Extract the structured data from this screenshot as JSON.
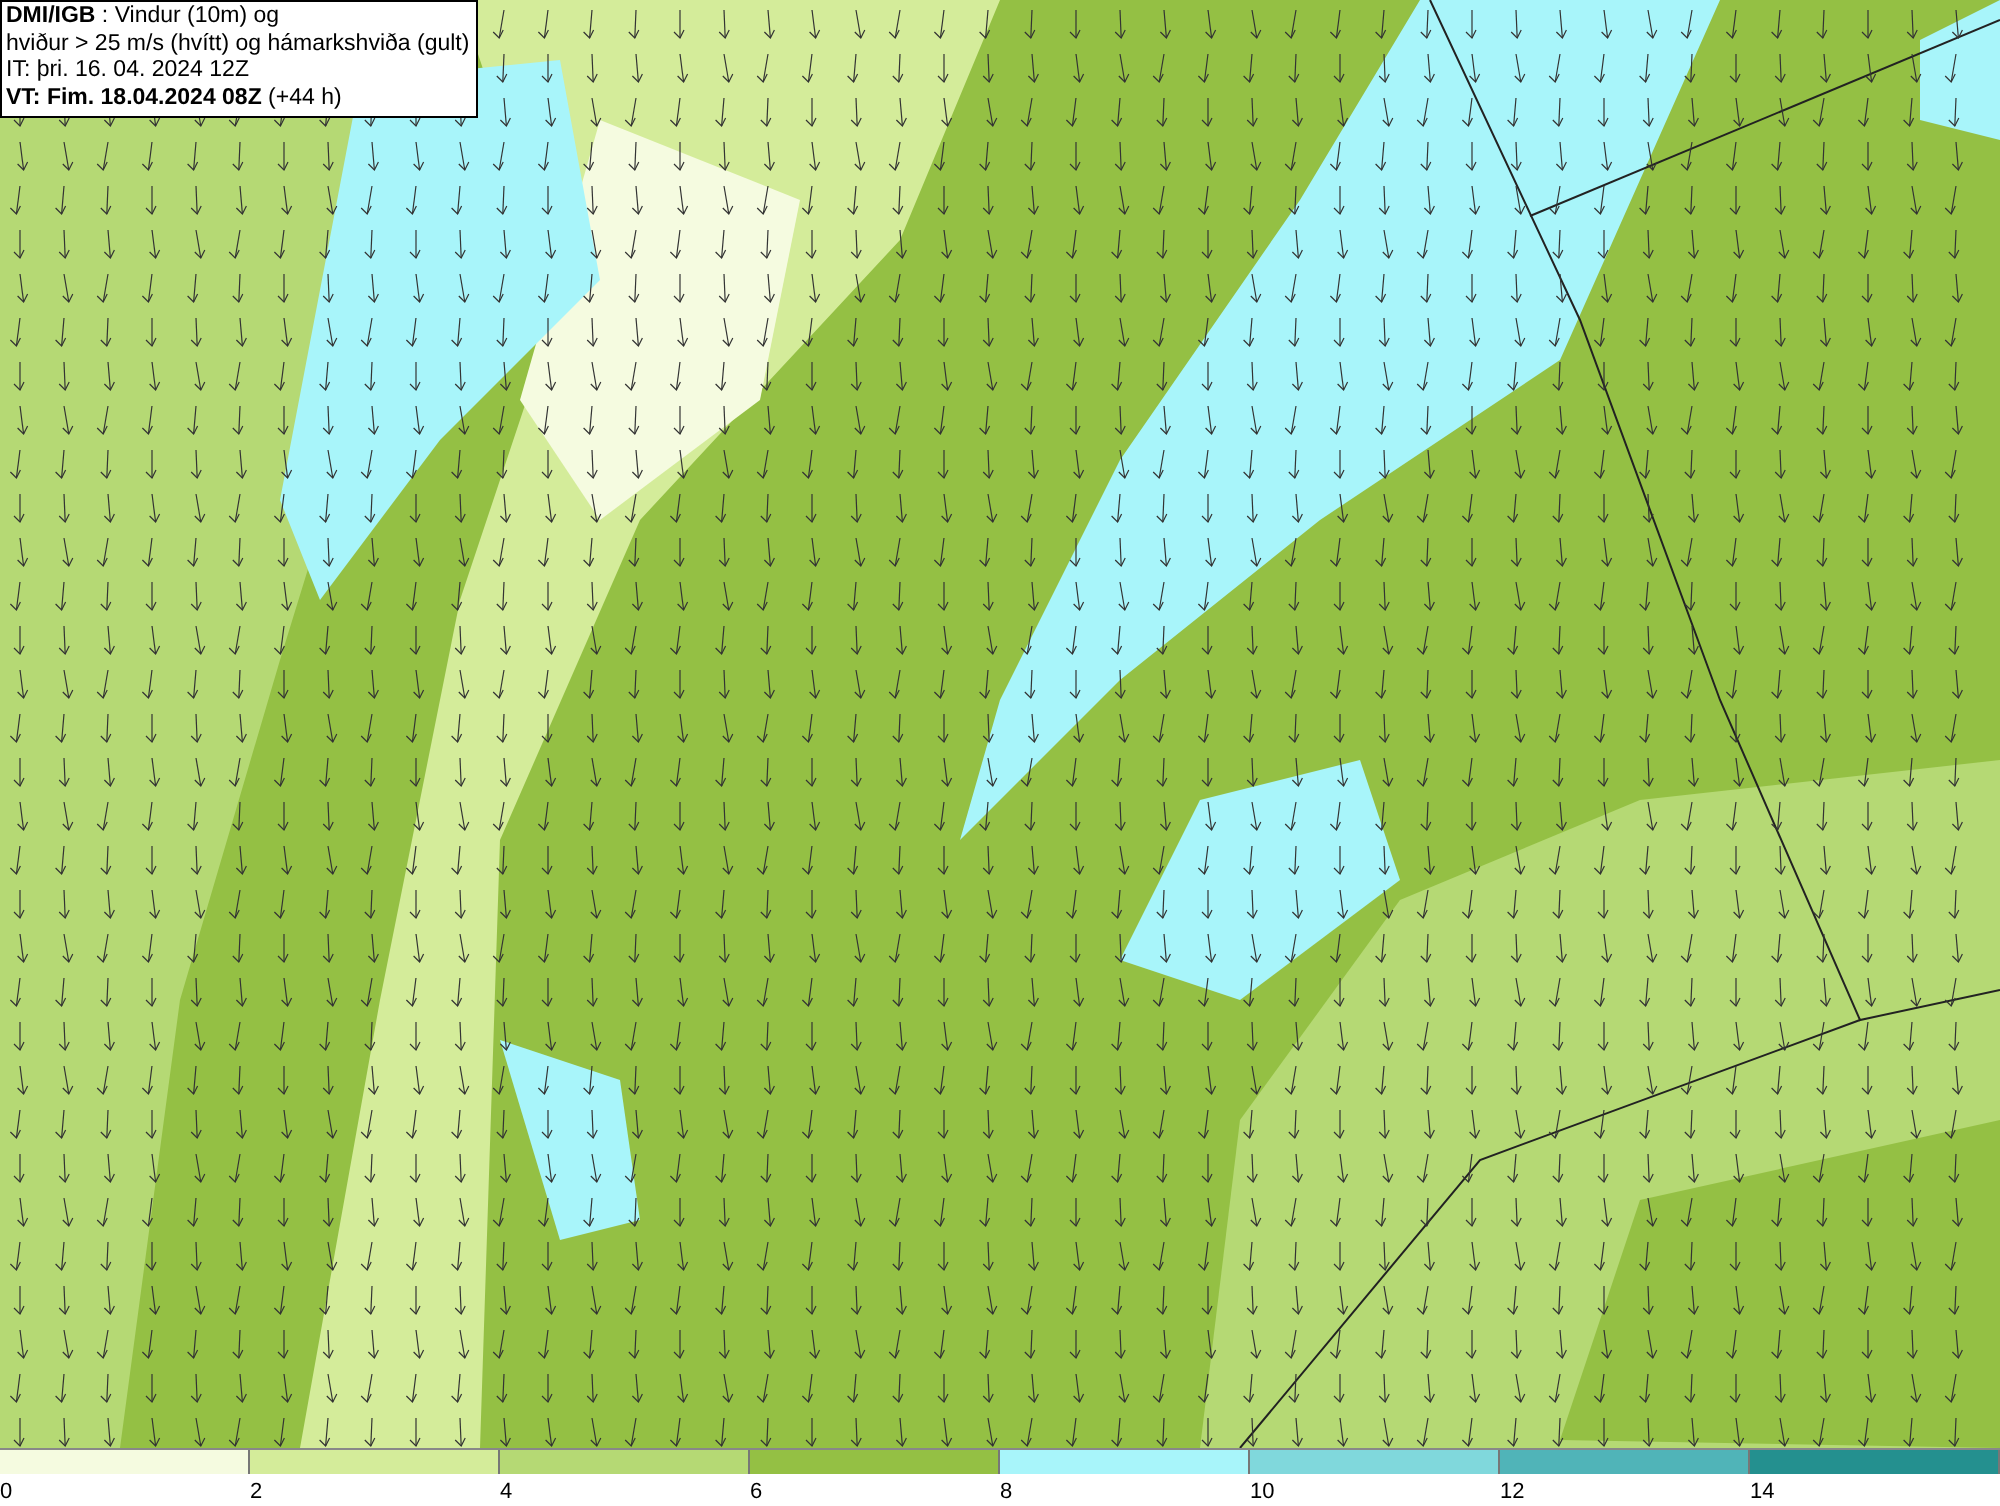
{
  "title_box": {
    "lines": [
      "**DMI/IGB** : Vindur (10m) og",
      "hviður > 25 m/s (hvítt) og hámarkshviða (gult)",
      "IT: þri. 16. 04. 2024 12Z",
      "**VT: Fim. 18.04.2024 08Z** (+44 h)"
    ]
  },
  "legend": {
    "bins": [
      {
        "color": "#f5fbe0"
      },
      {
        "color": "#d4ec9a"
      },
      {
        "color": "#b5d974"
      },
      {
        "color": "#94c044"
      },
      {
        "color": "#a8f5fa"
      },
      {
        "color": "#80d8dc"
      },
      {
        "color": "#50b4b8"
      },
      {
        "color": "#24908f"
      }
    ],
    "ticks": [
      "0",
      "2",
      "4",
      "6",
      "8",
      "10",
      "12",
      "14"
    ]
  }
}
